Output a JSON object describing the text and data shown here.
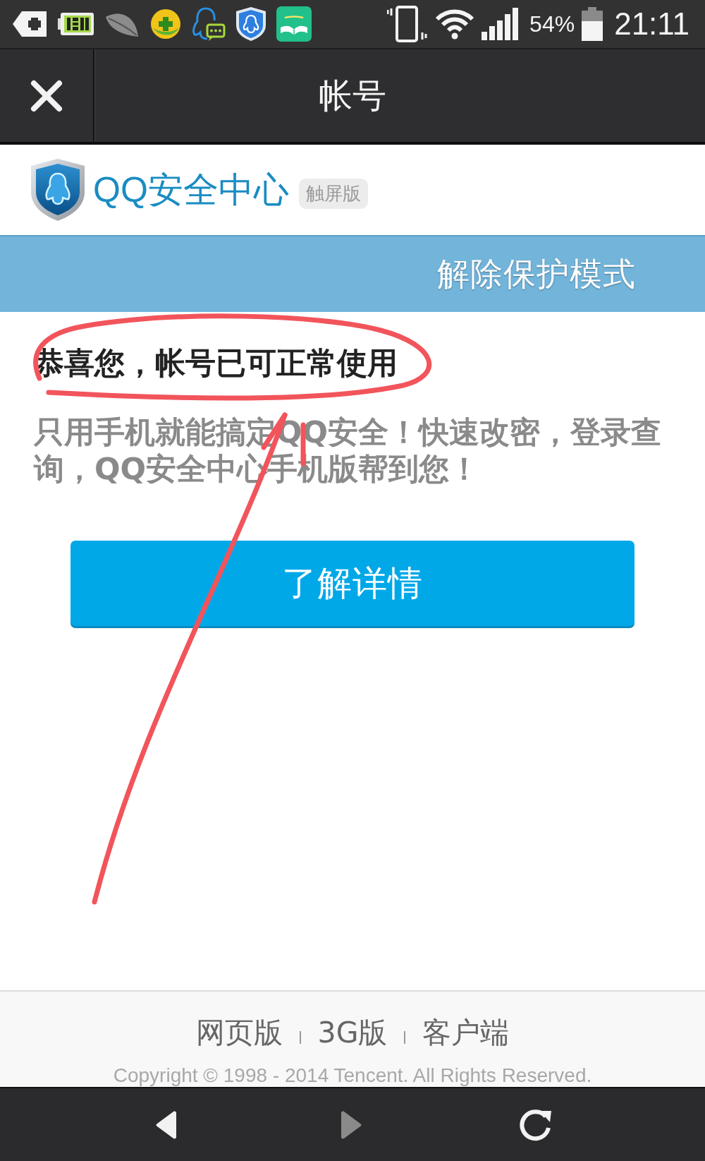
{
  "status_bar": {
    "battery_percent": "54%",
    "time": "21:11"
  },
  "title_bar": {
    "title": "帐号"
  },
  "brand": {
    "name": "QQ安全中心",
    "badge": "触屏版"
  },
  "section_bar": {
    "title": "解除保护模式"
  },
  "message": {
    "heading": "恭喜您，帐号已可正常使用",
    "body": "只用手机就能搞定QQ安全！快速改密，登录查询，QQ安全中心手机版帮到您！"
  },
  "primary_button": {
    "label": "了解详情"
  },
  "footer": {
    "links": [
      "网页版",
      "3G版",
      "客户端"
    ],
    "copyright": "Copyright © 1998 - 2014 Tencent. All Rights Reserved."
  },
  "nav_bar": {
    "buttons": [
      {
        "kind": "back",
        "disabled": false
      },
      {
        "kind": "forward",
        "disabled": true
      },
      {
        "kind": "refresh",
        "disabled": false
      }
    ]
  }
}
